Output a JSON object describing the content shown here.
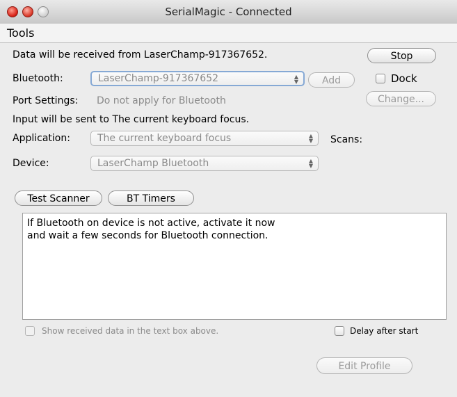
{
  "window": {
    "title": "SerialMagic - Connected"
  },
  "menu": {
    "tools": "Tools"
  },
  "status": {
    "received_from": "Data will be received from LaserChamp-917367652.",
    "input_sent_to": "Input will be sent to The current keyboard focus."
  },
  "buttons": {
    "stop": "Stop",
    "add": "Add",
    "change": "Change...",
    "test_scanner": "Test Scanner",
    "bt_timers": "BT Timers",
    "edit_profile": "Edit Profile"
  },
  "bluetooth": {
    "label": "Bluetooth:",
    "value": "LaserChamp-917367652"
  },
  "dock": {
    "label": "Dock"
  },
  "port_settings": {
    "label": "Port Settings:",
    "value": "Do not apply for Bluetooth"
  },
  "application": {
    "label": "Application:",
    "value": "The current keyboard focus"
  },
  "scans": {
    "label": "Scans:"
  },
  "device": {
    "label": "Device:",
    "value": "LaserChamp Bluetooth"
  },
  "output": {
    "line1": "If Bluetooth on device is not active, activate it now",
    "line2": "and wait a few seconds for Bluetooth connection."
  },
  "options": {
    "show_received": "Show received data in the text box above.",
    "delay_after_start": "Delay after start"
  }
}
